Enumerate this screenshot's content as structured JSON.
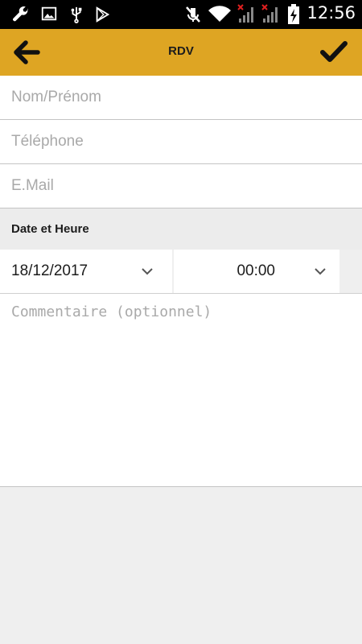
{
  "status_bar": {
    "time": "12:56",
    "icons": [
      "wrench-icon",
      "image-icon",
      "usb-icon",
      "play-store-icon",
      "mute-icon",
      "wifi-icon",
      "signal-no-service-icon",
      "signal-no-service-icon",
      "battery-charging-icon"
    ]
  },
  "app_bar": {
    "title": "RDV",
    "back_icon": "arrow-left-icon",
    "confirm_icon": "check-icon",
    "color": "#dea523"
  },
  "form": {
    "name_placeholder": "Nom/Prénom",
    "phone_placeholder": "Téléphone",
    "email_placeholder": "E.Mail",
    "section_title": "Date et Heure",
    "date_value": "18/12/2017",
    "time_value": "00:00",
    "comment_placeholder": "Commentaire (optionnel)"
  }
}
